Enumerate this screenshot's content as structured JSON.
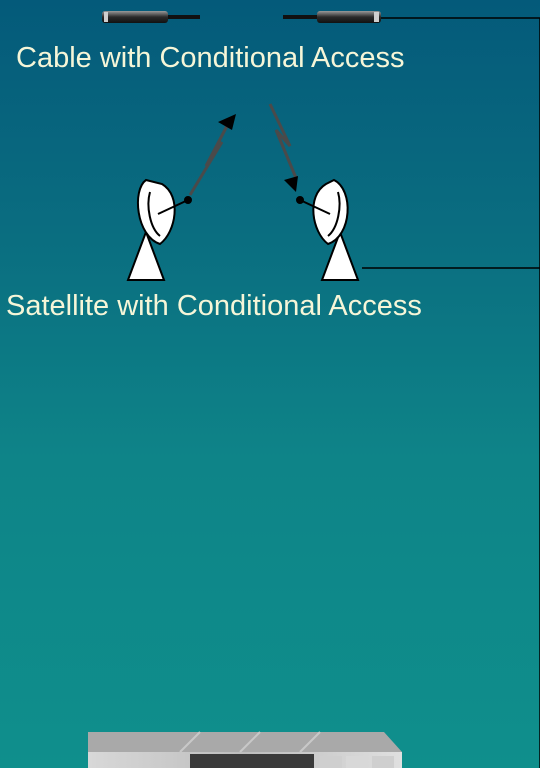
{
  "labels": {
    "cable": "Cable with Conditional Access",
    "satellite": "Satellite with Conditional Access"
  },
  "icons": [
    "cable-connector-icon",
    "satellite-dish-icon",
    "signal-bolt-icon",
    "receiver-box-icon"
  ],
  "colors": {
    "background_top": "#045a7a",
    "background_bottom": "#0f8f8c",
    "text": "#f6f6d8",
    "lines": "#000000"
  }
}
